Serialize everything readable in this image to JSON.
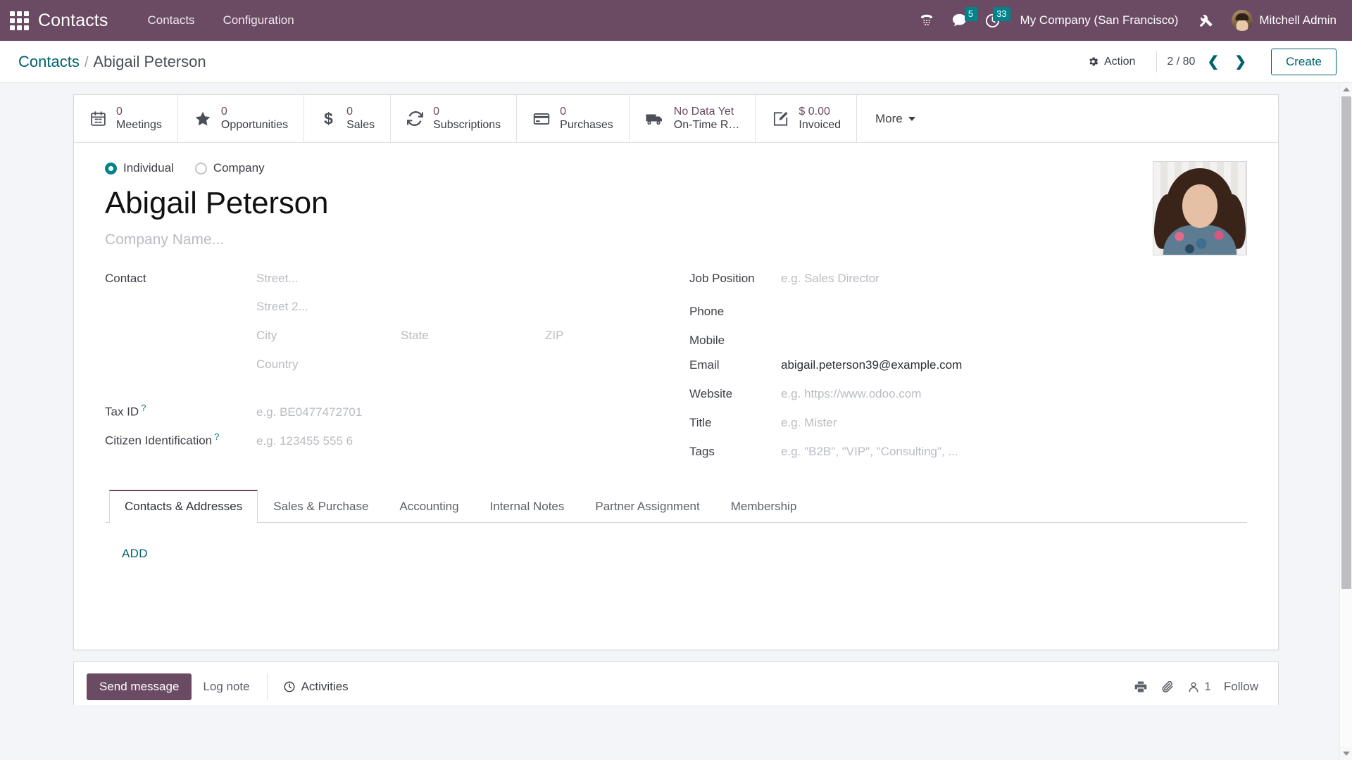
{
  "navbar": {
    "apps_icon": "apps-grid-icon",
    "brand": "Contacts",
    "menu": [
      {
        "label": "Contacts"
      },
      {
        "label": "Configuration"
      }
    ],
    "sys_icons": [
      {
        "name": "dialpad-phone-icon",
        "badge": null
      },
      {
        "name": "messages-icon",
        "badge": "5"
      },
      {
        "name": "activities-clock-icon",
        "badge": "33"
      },
      {
        "name": "tools-debug-icon",
        "badge": null
      }
    ],
    "company": "My Company (San Francisco)",
    "user": "Mitchell Admin",
    "navbar_color": "#6b4a63",
    "badge_color": "#00848b"
  },
  "control_panel": {
    "breadcrumb_root": "Contacts",
    "breadcrumb_sep": "/",
    "breadcrumb_current": "Abigail Peterson",
    "action_label": "Action",
    "pager": "2 / 80",
    "prev_icon": "chevron-left-icon",
    "next_icon": "chevron-right-icon",
    "create_label": "Create",
    "accent_color": "#00626b"
  },
  "stat_buttons": [
    {
      "icon": "calendar-icon",
      "value": "0",
      "label": "Meetings"
    },
    {
      "icon": "star-icon",
      "value": "0",
      "label": "Opportunities"
    },
    {
      "icon": "dollar-icon",
      "value": "0",
      "label": "Sales"
    },
    {
      "icon": "refresh-icon",
      "value": "0",
      "label": "Subscriptions"
    },
    {
      "icon": "credit-card-icon",
      "value": "0",
      "label": "Purchases"
    },
    {
      "icon": "truck-icon",
      "value": "No Data Yet",
      "label": "On-Time R…"
    },
    {
      "icon": "pencil-square-icon",
      "value": "$ 0.00",
      "label": "Invoiced"
    }
  ],
  "stat_more_label": "More",
  "form": {
    "type_options": [
      {
        "label": "Individual",
        "checked": true
      },
      {
        "label": "Company",
        "checked": false
      }
    ],
    "record_name": "Abigail Peterson",
    "company_name_placeholder": "Company Name...",
    "avatar_alt": "contact-photo",
    "left_fields": {
      "contact_label": "Contact",
      "street_placeholder": "Street...",
      "street2_placeholder": "Street 2...",
      "city_placeholder": "City",
      "state_placeholder": "State",
      "zip_placeholder": "ZIP",
      "country_placeholder": "Country",
      "tax_id_label": "Tax ID",
      "tax_id_placeholder": "e.g. BE0477472701",
      "citizen_id_label": "Citizen Identification",
      "citizen_id_placeholder": "e.g. 123455 555 6",
      "help_mark": "?"
    },
    "right_fields": [
      {
        "label": "Job Position",
        "value": "e.g. Sales Director",
        "is_placeholder": true
      },
      {
        "label": "Phone",
        "value": "",
        "is_placeholder": false
      },
      {
        "label": "Mobile",
        "value": "",
        "is_placeholder": false
      },
      {
        "label": "Email",
        "value": "abigail.peterson39@example.com",
        "is_placeholder": false
      },
      {
        "label": "Website",
        "value": "e.g. https://www.odoo.com",
        "is_placeholder": true
      },
      {
        "label": "Title",
        "value": "e.g. Mister",
        "is_placeholder": true
      },
      {
        "label": "Tags",
        "value": "e.g. \"B2B\", \"VIP\", \"Consulting\", ...",
        "is_placeholder": true
      }
    ]
  },
  "notebook": {
    "tabs": [
      {
        "label": "Contacts & Addresses",
        "active": true
      },
      {
        "label": "Sales & Purchase",
        "active": false
      },
      {
        "label": "Accounting",
        "active": false
      },
      {
        "label": "Internal Notes",
        "active": false
      },
      {
        "label": "Partner Assignment",
        "active": false
      },
      {
        "label": "Membership",
        "active": false
      }
    ],
    "add_label": "ADD"
  },
  "chatter": {
    "send_message": "Send message",
    "log_note": "Log note",
    "activities": "Activities",
    "activities_icon": "clock-icon",
    "print_icon": "printer-icon",
    "attach_icon": "paperclip-icon",
    "followers_icon": "user-icon",
    "followers_count": "1",
    "follow_label": "Follow"
  }
}
